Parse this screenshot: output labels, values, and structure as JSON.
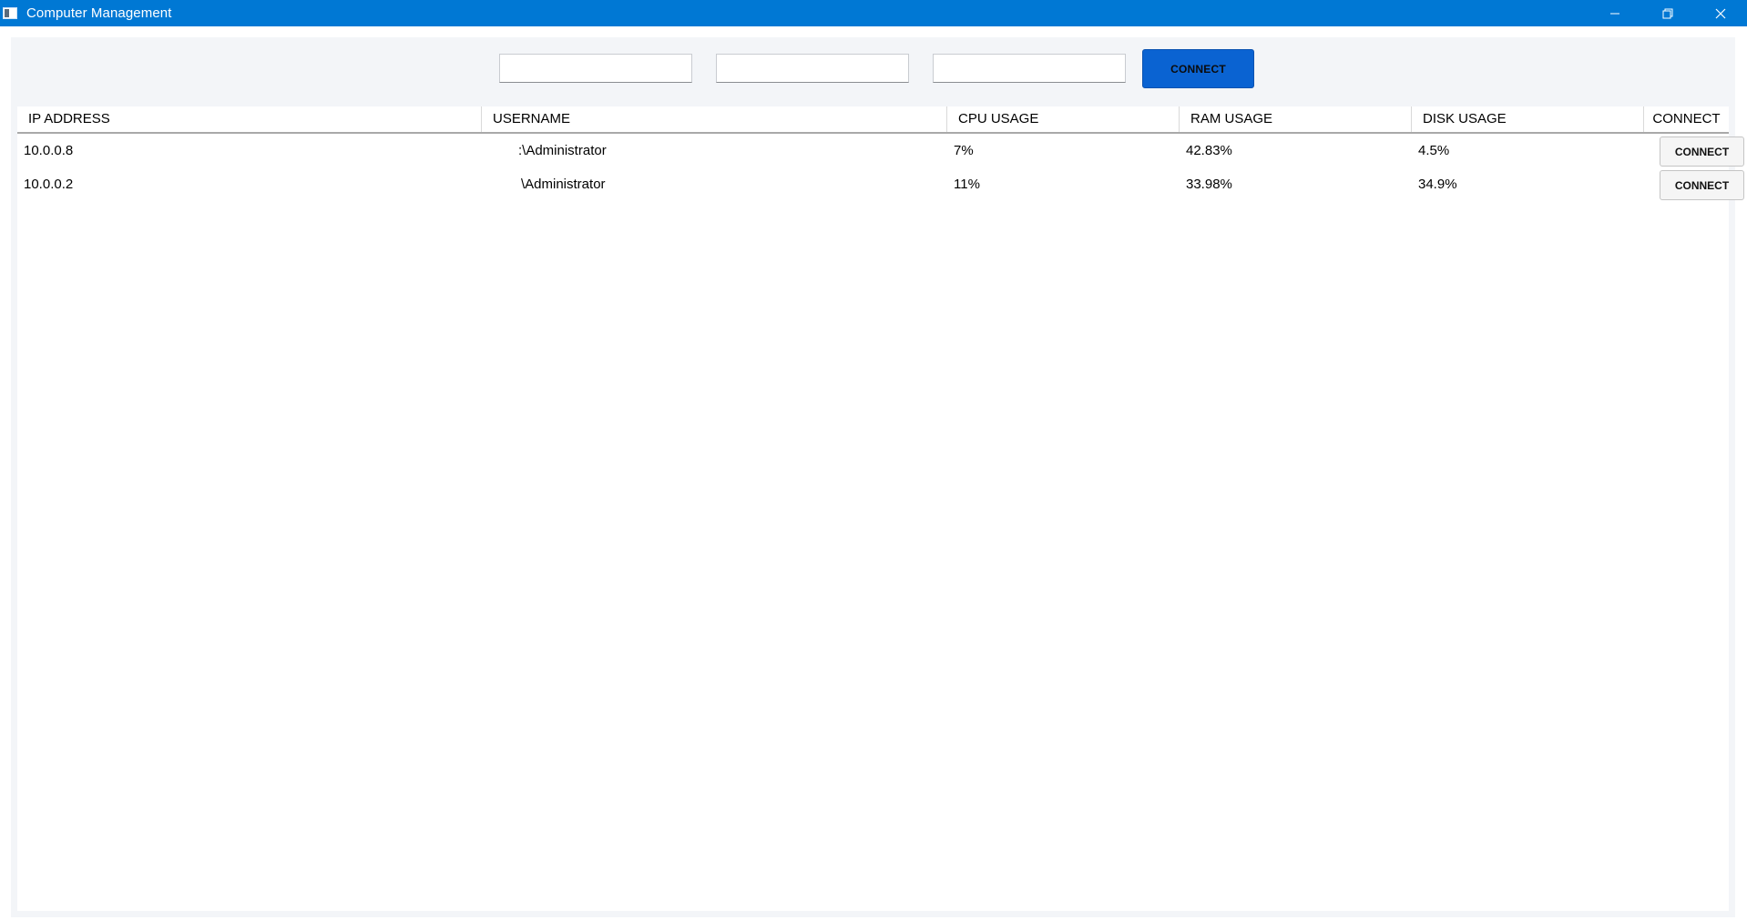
{
  "window": {
    "title": "Computer Management",
    "controls": {
      "minimize_icon": "minimize-icon",
      "restore_icon": "restore-icon",
      "close_icon": "close-icon"
    },
    "accent_color": "#0078d4"
  },
  "toolbar": {
    "inputs": [
      {
        "value": "",
        "placeholder": ""
      },
      {
        "value": "",
        "placeholder": ""
      },
      {
        "value": "",
        "placeholder": ""
      }
    ],
    "connect_label": "CONNECT",
    "connect_color": "#0a63d2"
  },
  "table": {
    "columns": [
      "IP ADDRESS",
      "USERNAME",
      "CPU USAGE",
      "RAM USAGE",
      "DISK USAGE",
      "CONNECT"
    ],
    "rows": [
      {
        "ip": "10.0.0.8",
        "username": ":\\Administrator",
        "cpu": "7%",
        "ram": "42.83%",
        "disk": "4.5%",
        "action": "CONNECT"
      },
      {
        "ip": "10.0.0.2",
        "username": "\\Administrator",
        "cpu": "11%",
        "ram": "33.98%",
        "disk": "34.9%",
        "action": "CONNECT"
      }
    ]
  }
}
